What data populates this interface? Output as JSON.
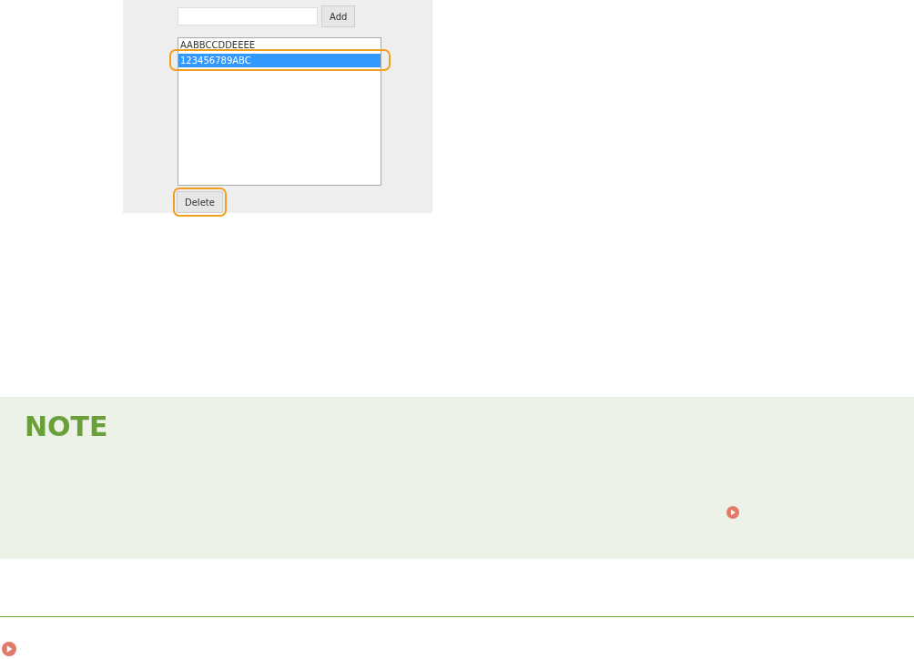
{
  "screenshot": {
    "add_button": "Add",
    "list": [
      {
        "text": "AABBCCDDEEEE",
        "selected": false,
        "callout": false
      },
      {
        "text": "123456789ABC",
        "selected": true,
        "callout": true
      }
    ],
    "delete_button": {
      "label": "Delete",
      "callout": true
    }
  },
  "note": {
    "title": "NOTE"
  }
}
